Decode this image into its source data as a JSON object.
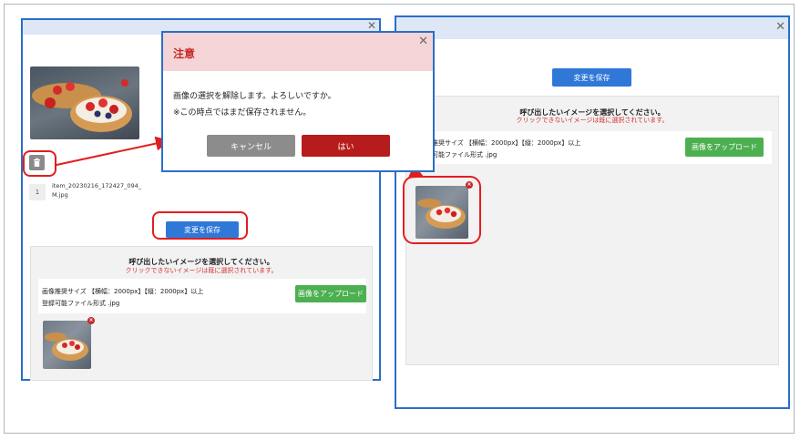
{
  "left_window": {
    "image_filename": "item_20230216_172427_094_M.jpg",
    "image_number": "1",
    "save_button": "変更を保存",
    "panel": {
      "title": "呼び出したいイメージを選択してください。",
      "subtitle": "クリックできないイメージは既に選択されています。",
      "size_line": "画像推奨サイズ 【横幅：2000px】【縦：2000px】以上",
      "format_line": "登録可能ファイル形式 .jpg",
      "upload_button": "画像をアップロード"
    }
  },
  "right_window": {
    "save_button": "変更を保存",
    "panel": {
      "title": "呼び出したいイメージを選択してください。",
      "subtitle": "クリックできないイメージは既に選択されています。",
      "size_line": "推奨サイズ 【横幅：2000px】【縦：2000px】以上",
      "format_line": "可能ファイル形式 .jpg",
      "upload_button": "画像をアップロード"
    }
  },
  "dialog": {
    "title": "注意",
    "message": "画像の選択を解除します。よろしいですか。",
    "note": "※この時点ではまだ保存されません。",
    "cancel_button": "キャンセル",
    "confirm_button": "はい"
  },
  "colors": {
    "accent_blue": "#2f78d8",
    "upload_green": "#4caf50",
    "confirm_red": "#b71c1c",
    "highlight_red": "#e31d1d",
    "warning_title": "#c62828"
  },
  "icons": {
    "close": "close-icon",
    "trash": "trash-icon",
    "remove": "remove-badge-icon"
  }
}
